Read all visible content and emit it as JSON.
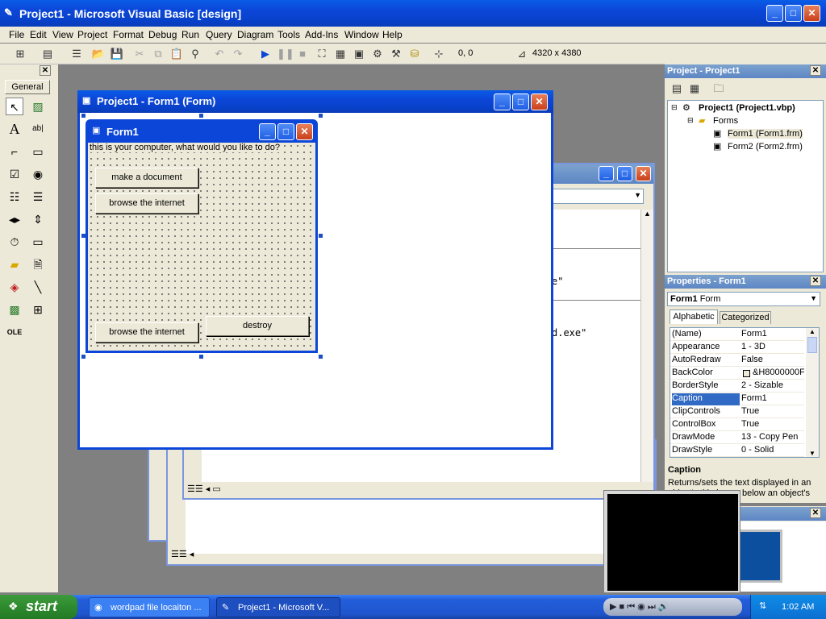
{
  "app": {
    "title": "Project1 - Microsoft Visual Basic [design]",
    "menu": [
      "File",
      "Edit",
      "View",
      "Project",
      "Format",
      "Debug",
      "Run",
      "Query",
      "Diagram",
      "Tools",
      "Add-Ins",
      "Window",
      "Help"
    ],
    "coords": "0, 0",
    "size": "4320 x 4380"
  },
  "toolbox": {
    "tab": "General"
  },
  "designer": {
    "title": "Project1 - Form1 (Form)"
  },
  "form1": {
    "title": "Form1",
    "label": "this is your computer, what would you like to do?",
    "buttons": [
      "make a document",
      "browse the internet",
      "browse the internet",
      "destroy"
    ]
  },
  "code_window": {
    "fragment1": "e\"",
    "fragment2": "d.exe\""
  },
  "project_explorer": {
    "title": "Project - Project1",
    "root": "Project1 (Project1.vbp)",
    "folder": "Forms",
    "items": [
      "Form1 (Form1.frm)",
      "Form2 (Form2.frm)"
    ]
  },
  "properties": {
    "title": "Properties - Form1",
    "object_bold": "Form1",
    "object_type": "Form",
    "tabs": [
      "Alphabetic",
      "Categorized"
    ],
    "rows": [
      {
        "name": "(Name)",
        "value": "Form1"
      },
      {
        "name": "Appearance",
        "value": "1 - 3D"
      },
      {
        "name": "AutoRedraw",
        "value": "False"
      },
      {
        "name": "BackColor",
        "value": "&H8000000F"
      },
      {
        "name": "BorderStyle",
        "value": "2 - Sizable"
      },
      {
        "name": "Caption",
        "value": "Form1"
      },
      {
        "name": "ClipControls",
        "value": "True"
      },
      {
        "name": "ControlBox",
        "value": "True"
      },
      {
        "name": "DrawMode",
        "value": "13 - Copy Pen"
      },
      {
        "name": "DrawStyle",
        "value": "0 - Solid"
      }
    ],
    "selected": "Caption",
    "desc_title": "Caption",
    "desc_text": "Returns/sets the text displayed in an object's title bar or below an object's"
  },
  "taskbar": {
    "start": "start",
    "tasks": [
      "wordpad file locaiton ...",
      "Project1 - Microsoft V..."
    ],
    "clock": "1:02 AM"
  },
  "colors": {
    "xp_blue": "#0b46d8",
    "selected_row": "#316ac5",
    "start_green": "#3c9a3c"
  }
}
